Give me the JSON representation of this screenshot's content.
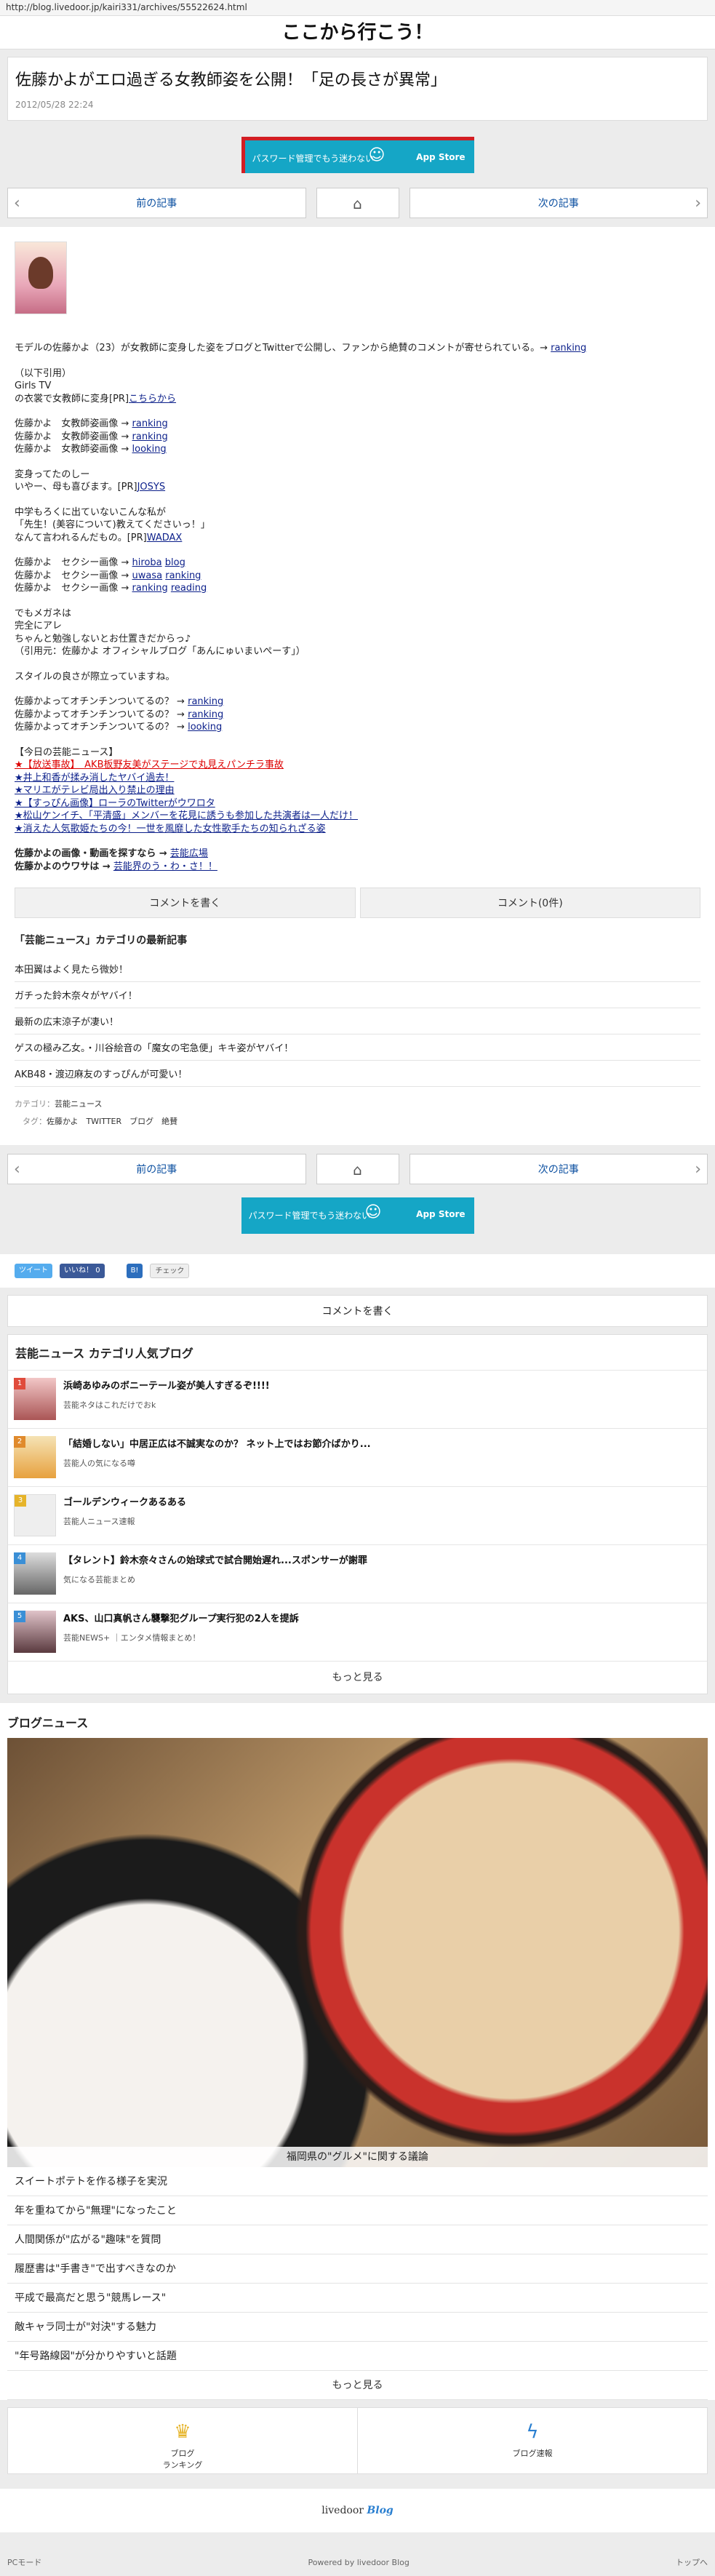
{
  "urlbar": "http://blog.livedoor.jp/kairi331/archives/55522624.html",
  "site_title": "ここから行こう！",
  "article": {
    "title": "佐藤かよがエロ過ぎる女教師姿を公開！「足の長さが異常」",
    "date": "2012/05/28 22:24"
  },
  "banner": {
    "text": "パスワード管理でもう迷わない",
    "app": "App Store"
  },
  "pager": {
    "prev": "前の記事",
    "home": "⌂",
    "next": "次の記事"
  },
  "body": {
    "intro": "モデルの佐藤かよ（23）が女教師に変身した姿をブログとTwitterで公開し、ファンから絶賛のコメントが寄せられている。→",
    "intro_link": "ranking",
    "quote_head": "（以下引用）",
    "source": "Girls TV",
    "pr1": "の衣裳で女教師に変身[PR]",
    "pr1_link": "こちらから",
    "lines1": [
      "佐藤かよ　女教師姿画像 →",
      "佐藤かよ　女教師姿画像 →",
      "佐藤かよ　女教師姿画像 →"
    ],
    "links1": [
      "ranking",
      "ranking",
      "looking"
    ],
    "p2a": "変身ってたのしー",
    "p2b": "いやー、母も喜びます。[PR]",
    "p2b_link": "JOSYS",
    "p3a": "中学もろくに出ていないこんな私が",
    "p3b": "「先生！(美容について)教えてくださいっ！」",
    "p3c": "なんて言われるんだもの。[PR]",
    "p3c_link": "WADAX",
    "lines2": [
      "佐藤かよ　セクシー画像 →",
      "佐藤かよ　セクシー画像 →",
      "佐藤かよ　セクシー画像 →"
    ],
    "links2a": [
      "hiroba",
      "uwasa",
      "ranking"
    ],
    "links2b": [
      "blog",
      "ranking",
      "reading"
    ],
    "p4a": "でもメガネは",
    "p4b": "完全にアレ",
    "p4c": "ちゃんと勉強しないとお仕置きだからっ♪",
    "p4d": "（引用元：佐藤かよ オフィシャルブログ「あんにゅいまいぺーす」）",
    "p5": "スタイルの良さが際立っていますね。",
    "lines3": [
      "佐藤かよってオチンチンついてるの？ →",
      "佐藤かよってオチンチンついてるの？ →",
      "佐藤かよってオチンチンついてるの？ →"
    ],
    "links3": [
      "ranking",
      "ranking",
      "looking"
    ],
    "today_head": "【今日の芸能ニュース】",
    "today": [
      "★【放送事故】　AKB板野友美がステージで丸見えパンチラ事故",
      "★井上和香が揉み消したヤバイ過去！",
      "★マリエがテレビ局出入り禁止の理由",
      "★【すっぴん画像】ローラのTwitterがウワロタ",
      "★松山ケンイチ、「平清盛」メンバーを花見に誘うも参加した共演者は一人だけ！",
      "★消えた人気歌姫たちの今！一世を風靡した女性歌手たちの知られざる姿"
    ],
    "end1": "佐藤かよの画像・動画を探すなら →",
    "end1_link": "芸能広場",
    "end2": "佐藤かよのウワサは →",
    "end2_link": "芸能界のう・わ・さ！！"
  },
  "buttons": {
    "comment_write": "コメントを書く",
    "comment_count": "コメント(0件)"
  },
  "latest": {
    "title": "「芸能ニュース」カテゴリの最新記事",
    "items": [
      "本田翼はよく見たら微妙！",
      "ガチった鈴木奈々がヤバイ！",
      "最新の広末涼子が凄い！",
      "ゲスの極み乙女。・川谷絵音の「魔女の宅急便」キキ姿がヤバイ！",
      "AKB48・渡辺麻友のすっぴんが可愛い！"
    ]
  },
  "cats": {
    "category_label": "カテゴリ：",
    "category": "芸能ニュース",
    "tag_label": "タグ：",
    "tags": [
      "佐藤かよ",
      "TWITTER",
      "ブログ",
      "絶賛"
    ]
  },
  "social": {
    "tweet": "ツイート",
    "like": "いいね！",
    "like_count": "0",
    "hatena": "B!",
    "check": "チェック"
  },
  "comment_write2": "コメントを書く",
  "rank": {
    "title": "芸能ニュース カテゴリ人気ブログ",
    "items": [
      {
        "num": "1",
        "title": "浜崎あゆみのボニーテール姿が美人すぎるぞ!!!!",
        "sub": "芸能ネタはこれだけでおk",
        "color": "#e04b3c"
      },
      {
        "num": "2",
        "title": "「結婚しない」中居正広は不誠実なのか？ ネット上ではお節介ばかり...",
        "sub": "芸能人の気になる噂",
        "color": "#e08a2c"
      },
      {
        "num": "3",
        "title": "ゴールデンウィークあるある",
        "sub": "芸能人ニュース速報",
        "color": "#e6b42a"
      },
      {
        "num": "4",
        "title": "【タレント】鈴木奈々さんの始球式で試合開始遅れ...スポンサーが謝罪",
        "sub": "気になる芸能まとめ",
        "color": "#3a8fd6"
      },
      {
        "num": "5",
        "title": "AKS、山口真帆さん襲撃犯グループ実行犯の2人を提訴",
        "sub": "芸能NEWS+ ｜エンタメ情報まとめ！",
        "color": "#3a8fd6"
      }
    ],
    "more": "もっと見る"
  },
  "news": {
    "title": "ブログニュース",
    "hero_caption": "福岡県の\"グルメ\"に関する議論",
    "items": [
      "スイートポテトを作る様子を実況",
      "年を重ねてから\"無理\"になったこと",
      "人間関係が\"広がる\"趣味\"を質問",
      "履歴書は\"手書き\"で出すべきなのか",
      "平成で最高だと思う\"競馬レース\"",
      "敵キャラ同士が\"対決\"する魅力",
      "\"年号路線図\"が分かりやすいと話題"
    ],
    "more": "もっと見る"
  },
  "footer_nav": {
    "ranking": "ブログ\nランキング",
    "ranking1": "ブログ",
    "ranking2": "ランキング",
    "breaking": "ブログ速報"
  },
  "logo": {
    "a": "livedoor",
    "b": "Blog"
  },
  "bottom": {
    "pc": "PCモード",
    "powered": "Powered by livedoor Blog",
    "top": "トップへ"
  }
}
